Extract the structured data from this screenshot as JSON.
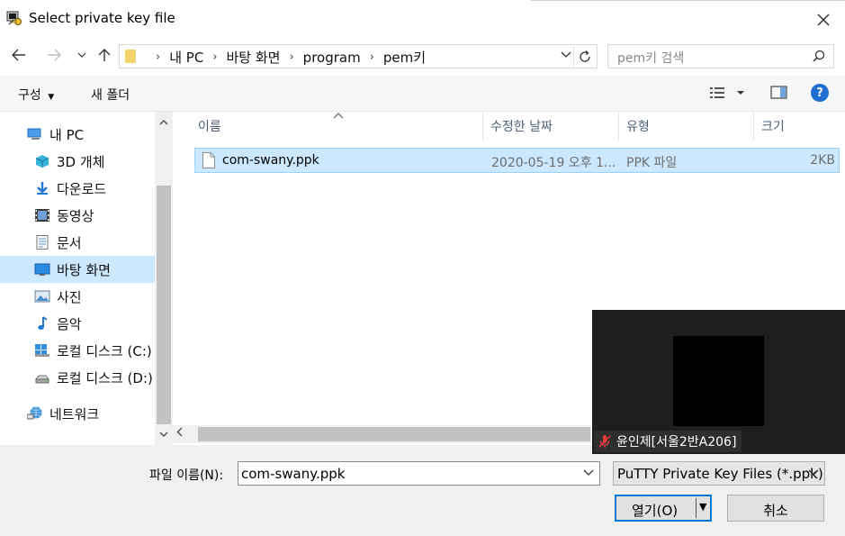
{
  "window": {
    "title": "Select private key file"
  },
  "nav": {
    "breadcrumbs": [
      "내 PC",
      "바탕 화면",
      "program",
      "pem키"
    ],
    "search_placeholder": "pem키 검색"
  },
  "toolbar": {
    "organize": "구성",
    "new_folder": "새 폴더"
  },
  "sidebar": {
    "items": [
      {
        "label": "내 PC",
        "icon": "pc-icon"
      },
      {
        "label": "3D 개체",
        "icon": "3d-objects-icon"
      },
      {
        "label": "다운로드",
        "icon": "download-icon"
      },
      {
        "label": "동영상",
        "icon": "video-icon"
      },
      {
        "label": "문서",
        "icon": "document-icon"
      },
      {
        "label": "바탕 화면",
        "icon": "desktop-icon",
        "selected": true
      },
      {
        "label": "사진",
        "icon": "picture-icon"
      },
      {
        "label": "음악",
        "icon": "music-icon"
      },
      {
        "label": "로컬 디스크 (C:)",
        "icon": "windows-drive-icon"
      },
      {
        "label": "로컬 디스크 (D:)",
        "icon": "drive-icon"
      },
      {
        "label": "네트워크",
        "icon": "network-icon"
      }
    ]
  },
  "columns": {
    "name": "이름",
    "modified": "수정한 날짜",
    "type": "유형",
    "size": "크기"
  },
  "files": [
    {
      "name": "com-swany.ppk",
      "modified": "2020-05-19 오후 1...",
      "type": "PPK 파일",
      "size": "2KB"
    }
  ],
  "footer": {
    "filename_label": "파일 이름(N):",
    "filename_value": "com-swany.ppk",
    "filetype_value": "PuTTY Private Key Files (*.ppk)",
    "open_label": "열기(O)",
    "cancel_label": "취소"
  },
  "overlay": {
    "participant_name": "윤인제[서울2반A206]"
  },
  "colors": {
    "accent": "#0078d7",
    "selection": "#cce8ff",
    "help": "#1f6fd1"
  }
}
